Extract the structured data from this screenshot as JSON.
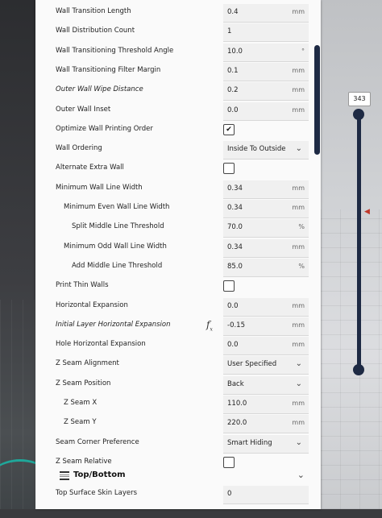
{
  "settings": [
    {
      "label": "Wall Transition Length",
      "type": "field",
      "value": "0.4",
      "unit": "mm",
      "indent": 0
    },
    {
      "label": "Wall Distribution Count",
      "type": "field",
      "value": "1",
      "unit": "",
      "indent": 0
    },
    {
      "label": "Wall Transitioning Threshold Angle",
      "type": "field",
      "value": "10.0",
      "unit": "°",
      "indent": 0
    },
    {
      "label": "Wall Transitioning Filter Margin",
      "type": "field",
      "value": "0.1",
      "unit": "mm",
      "indent": 0
    },
    {
      "label": "Outer Wall Wipe Distance",
      "type": "field",
      "value": "0.2",
      "unit": "mm",
      "indent": 0,
      "italic": true
    },
    {
      "label": "Outer Wall Inset",
      "type": "field",
      "value": "0.0",
      "unit": "mm",
      "indent": 0
    },
    {
      "label": "Optimize Wall Printing Order",
      "type": "checkbox",
      "checked": true,
      "indent": 0
    },
    {
      "label": "Wall Ordering",
      "type": "select",
      "value": "Inside To Outside",
      "indent": 0
    },
    {
      "label": "Alternate Extra Wall",
      "type": "checkbox",
      "checked": false,
      "indent": 0
    },
    {
      "label": "Minimum Wall Line Width",
      "type": "field",
      "value": "0.34",
      "unit": "mm",
      "indent": 0
    },
    {
      "label": "Minimum Even Wall Line Width",
      "type": "field",
      "value": "0.34",
      "unit": "mm",
      "indent": 1
    },
    {
      "label": "Split Middle Line Threshold",
      "type": "field",
      "value": "70.0",
      "unit": "%",
      "indent": 2
    },
    {
      "label": "Minimum Odd Wall Line Width",
      "type": "field",
      "value": "0.34",
      "unit": "mm",
      "indent": 1
    },
    {
      "label": "Add Middle Line Threshold",
      "type": "field",
      "value": "85.0",
      "unit": "%",
      "indent": 2
    },
    {
      "label": "Print Thin Walls",
      "type": "checkbox",
      "checked": false,
      "indent": 0
    },
    {
      "label": "Horizontal Expansion",
      "type": "field",
      "value": "0.0",
      "unit": "mm",
      "indent": 0
    },
    {
      "label": "Initial Layer Horizontal Expansion",
      "type": "field",
      "value": "-0.15",
      "unit": "mm",
      "indent": 0,
      "italic": true,
      "fx": "fx"
    },
    {
      "label": "Hole Horizontal Expansion",
      "type": "field",
      "value": "0.0",
      "unit": "mm",
      "indent": 0
    },
    {
      "label": "Z Seam Alignment",
      "type": "select",
      "value": "User Specified",
      "indent": 0
    },
    {
      "label": "Z Seam Position",
      "type": "select",
      "value": "Back",
      "indent": 0
    },
    {
      "label": "Z Seam X",
      "type": "field",
      "value": "110.0",
      "unit": "mm",
      "indent": 1
    },
    {
      "label": "Z Seam Y",
      "type": "field",
      "value": "220.0",
      "unit": "mm",
      "indent": 1
    },
    {
      "label": "Seam Corner Preference",
      "type": "select",
      "value": "Smart Hiding",
      "indent": 0
    },
    {
      "label": "Z Seam Relative",
      "type": "checkbox",
      "checked": false,
      "indent": 0
    }
  ],
  "section": {
    "title": "Top/Bottom",
    "icon": "top-bottom-icon"
  },
  "after_section": [
    {
      "label": "Top Surface Skin Layers",
      "type": "field",
      "value": "0",
      "unit": "",
      "indent": 0
    }
  ],
  "layer_slider": {
    "value": "343"
  },
  "colors": {
    "panel": "#fafafa",
    "slider": "#1e2a44",
    "field": "#f0f0f0"
  }
}
